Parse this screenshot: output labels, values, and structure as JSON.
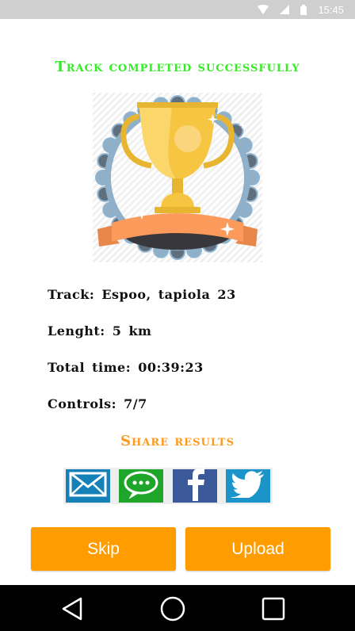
{
  "status_bar": {
    "time": "15:45"
  },
  "title": "Track completed successfully",
  "info": {
    "track": "Track: Espoo, tapiola 23",
    "length": "Lenght: 5 km",
    "total_time": "Total time: 00:39:23",
    "controls": "Controls: 7/7"
  },
  "share": {
    "title": "Share results",
    "buttons": [
      {
        "icon": "email-icon",
        "color": "#1680b8"
      },
      {
        "icon": "message-icon",
        "color": "#1fa52a"
      },
      {
        "icon": "facebook-icon",
        "color": "#3b5998"
      },
      {
        "icon": "twitter-icon",
        "color": "#1b95c9"
      }
    ]
  },
  "buttons": {
    "skip": "Skip",
    "upload": "Upload"
  },
  "colors": {
    "title": "#33ee22",
    "share_title": "#ff9a1c",
    "button": "#ff9c00",
    "nav_bar": "#000000"
  }
}
